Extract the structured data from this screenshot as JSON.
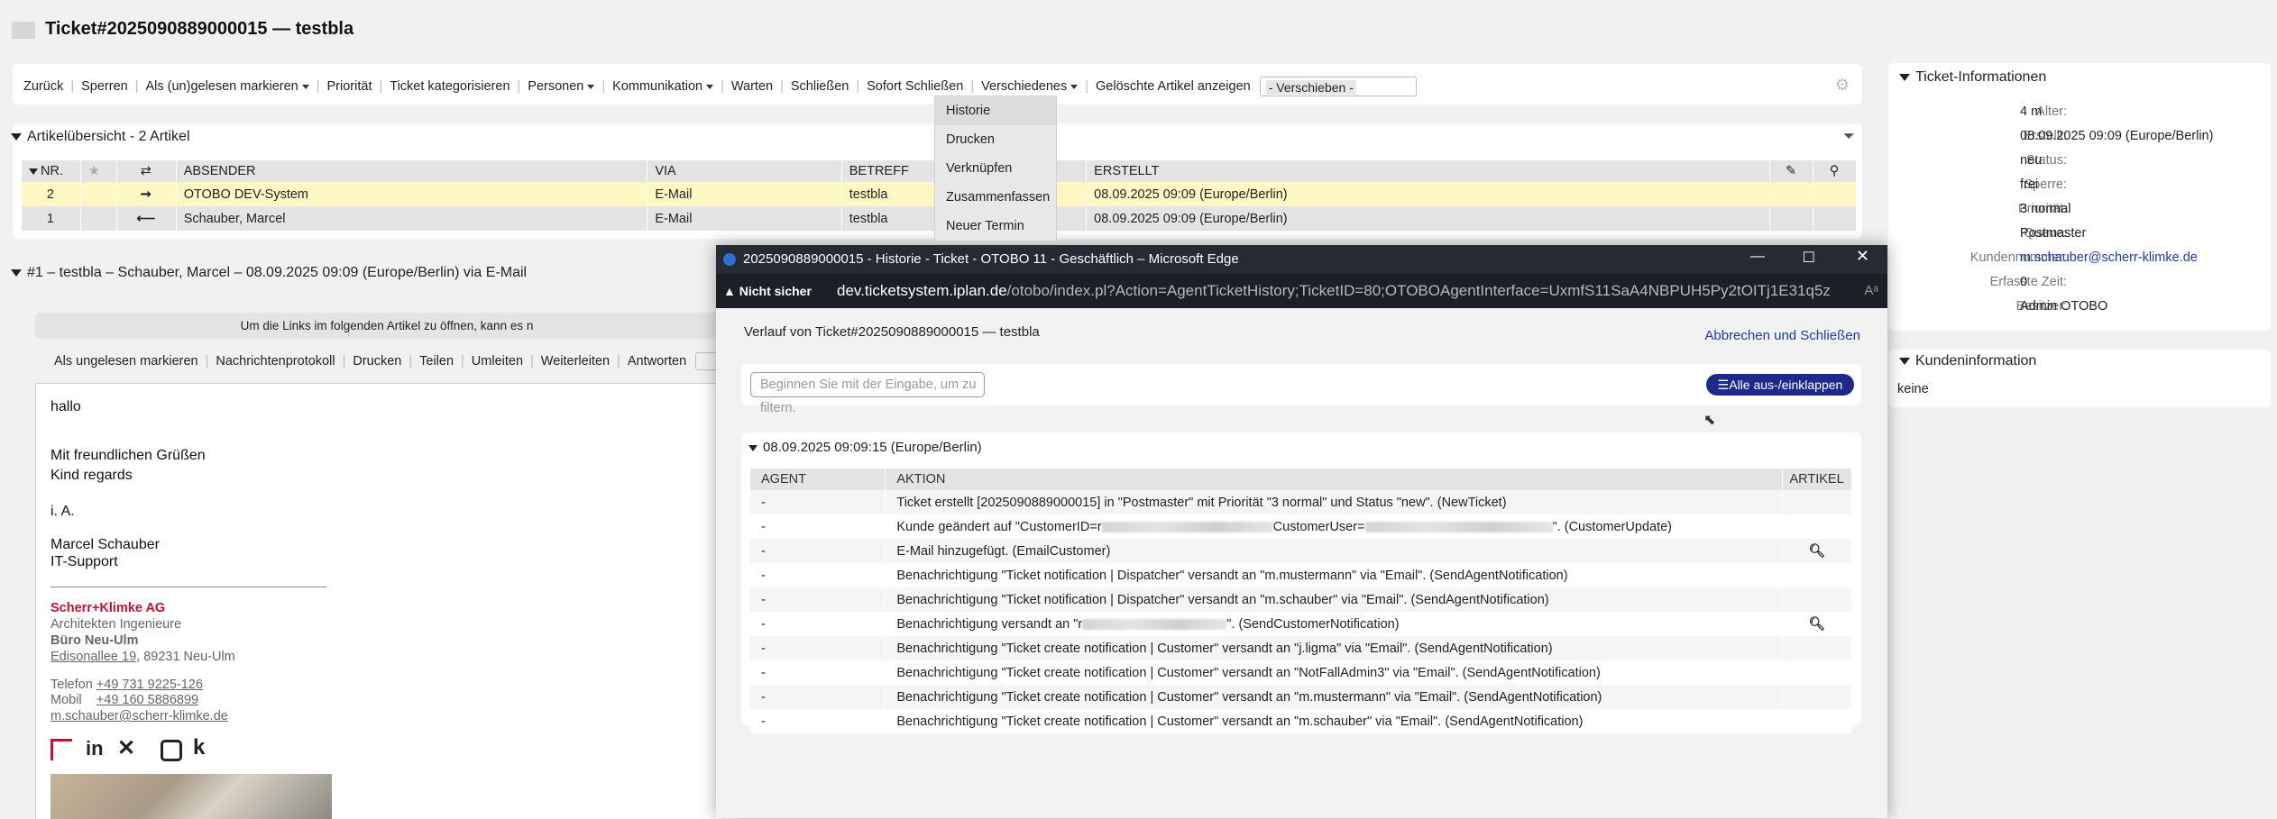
{
  "header": {
    "title": "Ticket#2025090889000015 — testbla"
  },
  "actions": {
    "items": [
      "Zurück",
      "Sperren",
      "Als (un)gelesen markieren",
      "Priorität",
      "Ticket kategorisieren",
      "Personen",
      "Kommunikation",
      "Warten",
      "Schließen",
      "Sofort Schließen",
      "Verschiedenes",
      "Gelöschte Artikel anzeigen"
    ],
    "move_placeholder": "- Verschieben -"
  },
  "misc_menu": [
    "Historie",
    "Drucken",
    "Verknüpfen",
    "Zusammenfassen",
    "Neuer Termin"
  ],
  "overview": {
    "title": "Artikelübersicht - 2 Artikel",
    "columns": [
      "NR.",
      "",
      "",
      "ABSENDER",
      "VIA",
      "BETREFF",
      "",
      "ERSTELLT",
      "",
      ""
    ],
    "rows": [
      {
        "nr": "2",
        "dir": "➞",
        "sender": "OTOBO DEV-System",
        "via": "E-Mail",
        "subject": "testbla",
        "created": "08.09.2025 09:09 (Europe/Berlin)"
      },
      {
        "nr": "1",
        "dir": "⟵",
        "sender": "Schauber, Marcel",
        "via": "E-Mail",
        "subject": "testbla",
        "created": "08.09.2025 09:09 (Europe/Berlin)"
      }
    ]
  },
  "article": {
    "heading": "#1 – testbla – Schauber, Marcel – 08.09.2025 09:09 (Europe/Berlin) via E-Mail",
    "notice": "Um die Links im folgenden Artikel zu öffnen, kann es n",
    "actions": [
      "Als ungelesen markieren",
      "Nachrichtenprotokoll",
      "Drucken",
      "Teilen",
      "Umleiten",
      "Weiterleiten",
      "Antworten"
    ],
    "body": {
      "greeting": "hallo",
      "regards1": "Mit freundlichen Grüßen",
      "regards2": "Kind regards",
      "ia": "i. A.",
      "name": "Marcel Schauber",
      "dept": "IT-Support",
      "company": "Scherr+Klimke AG",
      "company_sub": "Architekten Ingenieure",
      "office": "Büro Neu-Ulm",
      "street": "Edisonallee 19",
      "city": ", 89231 Neu-Ulm",
      "phone_label": "Telefon",
      "phone": "+49 731 9225-126",
      "mobile_label": "Mobil",
      "mobile": "+49 160 5886899",
      "email": "m.schauber@scherr-klimke.de"
    }
  },
  "ticket_info": {
    "title": "Ticket-Informationen",
    "fields": [
      {
        "k": "Alter:",
        "v": "4 m"
      },
      {
        "k": "Erstellt:",
        "v": "08.09.2025 09:09 (Europe/Berlin)"
      },
      {
        "k": "Status:",
        "v": "neu"
      },
      {
        "k": "Sperre:",
        "v": "frei"
      },
      {
        "k": "Priorität:",
        "v": "3 normal"
      },
      {
        "k": "Queue:",
        "v": "Postmaster"
      },
      {
        "k": "Kundennummer:",
        "v": "m.schauber@scherr-klimke.de"
      },
      {
        "k": "Erfasste Zeit:",
        "v": "0"
      },
      {
        "k": "Besitzer:",
        "v": "Admin OTOBO"
      }
    ]
  },
  "customer_info": {
    "title": "Kundeninformation",
    "value": "keine"
  },
  "popup": {
    "window_title": "2025090889000015 - Historie - Ticket - OTOBO 11 - Geschäftlich – Microsoft Edge",
    "not_secure": "Nicht sicher",
    "url_host": "dev.ticketsystem.iplan.de",
    "url_rest": "/otobo/index.pl?Action=AgentTicketHistory;TicketID=80;OTOBOAgentInterface=UxmfS11SaA4NBPUH5Py2tOITj1E31q5z",
    "heading": "Verlauf von Ticket#2025090889000015 — testbla",
    "close_link": "Abbrechen und Schließen",
    "filter_placeholder": "Beginnen Sie mit der Eingabe, um zu filtern.",
    "toggle_label": "Alle aus-/einklappen",
    "group": "08.09.2025 09:09:15 (Europe/Berlin)",
    "columns": [
      "AGENT",
      "AKTION",
      "ARTIKEL"
    ],
    "rows": [
      {
        "agent": "-",
        "action": "Ticket erstellt [2025090889000015] in \"Postmaster\" mit Priorität \"3 normal\" und Status \"new\". (NewTicket)"
      },
      {
        "agent": "-",
        "action_a": "Kunde geändert auf \"CustomerID=r",
        "action_b": "CustomerUser=",
        "action_c": "\". (CustomerUpdate)"
      },
      {
        "agent": "-",
        "action": "E-Mail hinzugefügt. (EmailCustomer)",
        "article": true
      },
      {
        "agent": "-",
        "action": "Benachrichtigung \"Ticket notification | Dispatcher\" versandt an \"m.mustermann\" via \"Email\". (SendAgentNotification)"
      },
      {
        "agent": "-",
        "action": "Benachrichtigung \"Ticket notification | Dispatcher\" versandt an \"m.schauber\" via \"Email\". (SendAgentNotification)"
      },
      {
        "agent": "-",
        "action_a": "Benachrichtigung versandt an \"r",
        "action_c": "\". (SendCustomerNotification)",
        "article": true
      },
      {
        "agent": "-",
        "action": "Benachrichtigung \"Ticket create notification | Customer\" versandt an \"j.ligma\" via \"Email\". (SendAgentNotification)"
      },
      {
        "agent": "-",
        "action": "Benachrichtigung \"Ticket create notification | Customer\" versandt an \"NotFallAdmin3\" via \"Email\". (SendAgentNotification)"
      },
      {
        "agent": "-",
        "action": "Benachrichtigung \"Ticket create notification | Customer\" versandt an \"m.mustermann\" via \"Email\". (SendAgentNotification)"
      },
      {
        "agent": "-",
        "action": "Benachrichtigung \"Ticket create notification | Customer\" versandt an \"m.schauber\" via \"Email\". (SendAgentNotification)"
      }
    ]
  }
}
